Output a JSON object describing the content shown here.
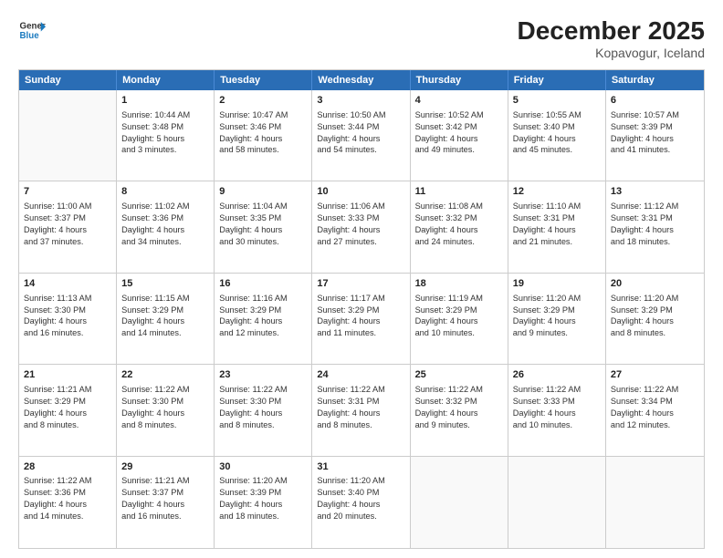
{
  "logo": {
    "line1": "General",
    "line2": "Blue"
  },
  "title": "December 2025",
  "subtitle": "Kopavogur, Iceland",
  "weekdays": [
    "Sunday",
    "Monday",
    "Tuesday",
    "Wednesday",
    "Thursday",
    "Friday",
    "Saturday"
  ],
  "weeks": [
    [
      {
        "day": "",
        "info": ""
      },
      {
        "day": "1",
        "info": "Sunrise: 10:44 AM\nSunset: 3:48 PM\nDaylight: 5 hours\nand 3 minutes."
      },
      {
        "day": "2",
        "info": "Sunrise: 10:47 AM\nSunset: 3:46 PM\nDaylight: 4 hours\nand 58 minutes."
      },
      {
        "day": "3",
        "info": "Sunrise: 10:50 AM\nSunset: 3:44 PM\nDaylight: 4 hours\nand 54 minutes."
      },
      {
        "day": "4",
        "info": "Sunrise: 10:52 AM\nSunset: 3:42 PM\nDaylight: 4 hours\nand 49 minutes."
      },
      {
        "day": "5",
        "info": "Sunrise: 10:55 AM\nSunset: 3:40 PM\nDaylight: 4 hours\nand 45 minutes."
      },
      {
        "day": "6",
        "info": "Sunrise: 10:57 AM\nSunset: 3:39 PM\nDaylight: 4 hours\nand 41 minutes."
      }
    ],
    [
      {
        "day": "7",
        "info": "Sunrise: 11:00 AM\nSunset: 3:37 PM\nDaylight: 4 hours\nand 37 minutes."
      },
      {
        "day": "8",
        "info": "Sunrise: 11:02 AM\nSunset: 3:36 PM\nDaylight: 4 hours\nand 34 minutes."
      },
      {
        "day": "9",
        "info": "Sunrise: 11:04 AM\nSunset: 3:35 PM\nDaylight: 4 hours\nand 30 minutes."
      },
      {
        "day": "10",
        "info": "Sunrise: 11:06 AM\nSunset: 3:33 PM\nDaylight: 4 hours\nand 27 minutes."
      },
      {
        "day": "11",
        "info": "Sunrise: 11:08 AM\nSunset: 3:32 PM\nDaylight: 4 hours\nand 24 minutes."
      },
      {
        "day": "12",
        "info": "Sunrise: 11:10 AM\nSunset: 3:31 PM\nDaylight: 4 hours\nand 21 minutes."
      },
      {
        "day": "13",
        "info": "Sunrise: 11:12 AM\nSunset: 3:31 PM\nDaylight: 4 hours\nand 18 minutes."
      }
    ],
    [
      {
        "day": "14",
        "info": "Sunrise: 11:13 AM\nSunset: 3:30 PM\nDaylight: 4 hours\nand 16 minutes."
      },
      {
        "day": "15",
        "info": "Sunrise: 11:15 AM\nSunset: 3:29 PM\nDaylight: 4 hours\nand 14 minutes."
      },
      {
        "day": "16",
        "info": "Sunrise: 11:16 AM\nSunset: 3:29 PM\nDaylight: 4 hours\nand 12 minutes."
      },
      {
        "day": "17",
        "info": "Sunrise: 11:17 AM\nSunset: 3:29 PM\nDaylight: 4 hours\nand 11 minutes."
      },
      {
        "day": "18",
        "info": "Sunrise: 11:19 AM\nSunset: 3:29 PM\nDaylight: 4 hours\nand 10 minutes."
      },
      {
        "day": "19",
        "info": "Sunrise: 11:20 AM\nSunset: 3:29 PM\nDaylight: 4 hours\nand 9 minutes."
      },
      {
        "day": "20",
        "info": "Sunrise: 11:20 AM\nSunset: 3:29 PM\nDaylight: 4 hours\nand 8 minutes."
      }
    ],
    [
      {
        "day": "21",
        "info": "Sunrise: 11:21 AM\nSunset: 3:29 PM\nDaylight: 4 hours\nand 8 minutes."
      },
      {
        "day": "22",
        "info": "Sunrise: 11:22 AM\nSunset: 3:30 PM\nDaylight: 4 hours\nand 8 minutes."
      },
      {
        "day": "23",
        "info": "Sunrise: 11:22 AM\nSunset: 3:30 PM\nDaylight: 4 hours\nand 8 minutes."
      },
      {
        "day": "24",
        "info": "Sunrise: 11:22 AM\nSunset: 3:31 PM\nDaylight: 4 hours\nand 8 minutes."
      },
      {
        "day": "25",
        "info": "Sunrise: 11:22 AM\nSunset: 3:32 PM\nDaylight: 4 hours\nand 9 minutes."
      },
      {
        "day": "26",
        "info": "Sunrise: 11:22 AM\nSunset: 3:33 PM\nDaylight: 4 hours\nand 10 minutes."
      },
      {
        "day": "27",
        "info": "Sunrise: 11:22 AM\nSunset: 3:34 PM\nDaylight: 4 hours\nand 12 minutes."
      }
    ],
    [
      {
        "day": "28",
        "info": "Sunrise: 11:22 AM\nSunset: 3:36 PM\nDaylight: 4 hours\nand 14 minutes."
      },
      {
        "day": "29",
        "info": "Sunrise: 11:21 AM\nSunset: 3:37 PM\nDaylight: 4 hours\nand 16 minutes."
      },
      {
        "day": "30",
        "info": "Sunrise: 11:20 AM\nSunset: 3:39 PM\nDaylight: 4 hours\nand 18 minutes."
      },
      {
        "day": "31",
        "info": "Sunrise: 11:20 AM\nSunset: 3:40 PM\nDaylight: 4 hours\nand 20 minutes."
      },
      {
        "day": "",
        "info": ""
      },
      {
        "day": "",
        "info": ""
      },
      {
        "day": "",
        "info": ""
      }
    ]
  ]
}
